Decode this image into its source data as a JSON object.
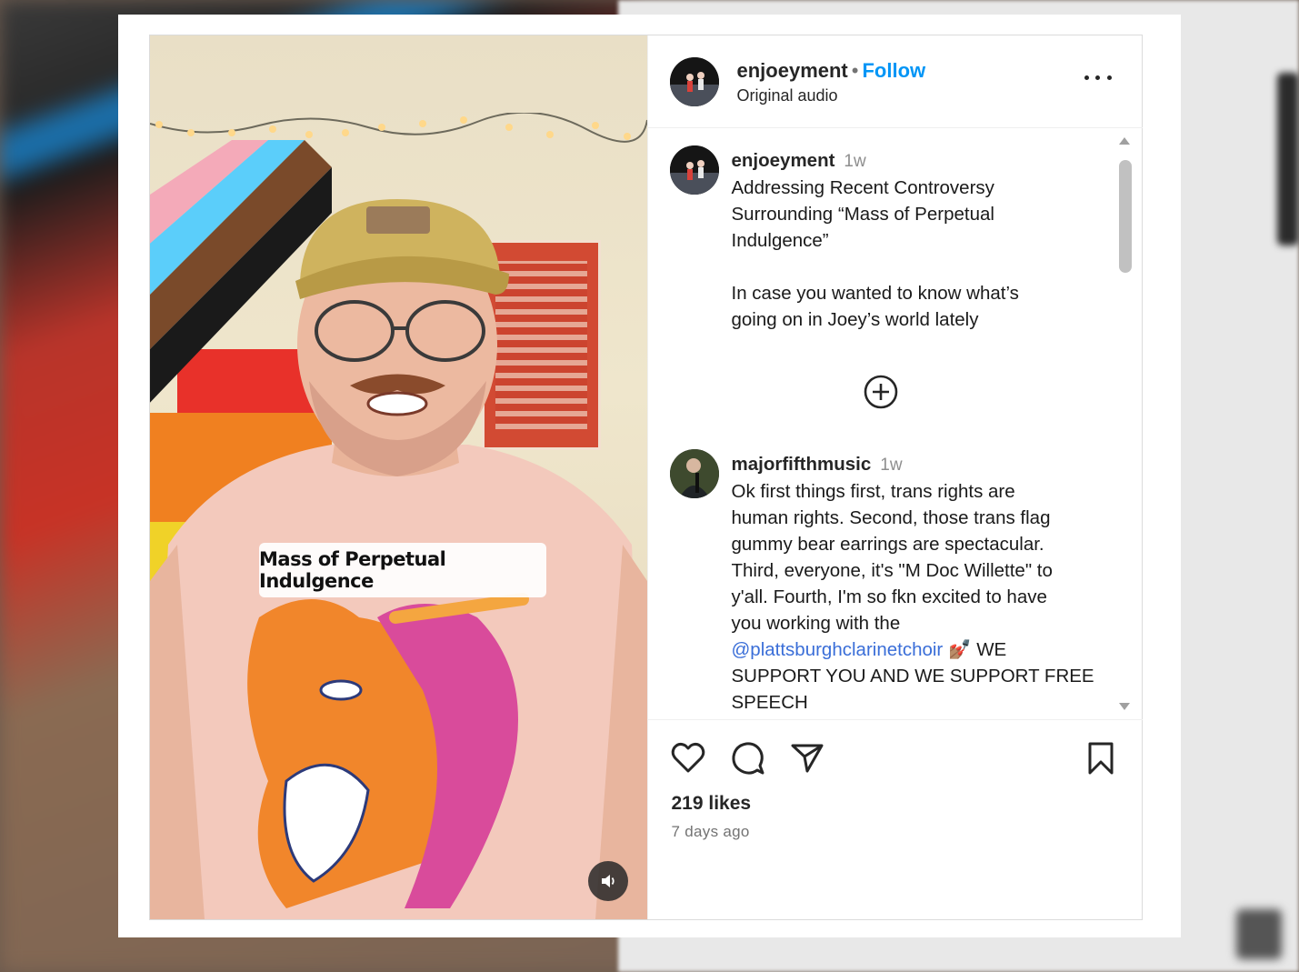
{
  "post": {
    "author": "enjoeyment",
    "separator": "•",
    "follow_label": "Follow",
    "audio_label": "Original audio",
    "video_caption": "Mass of Perpetual Indulgence"
  },
  "caption": {
    "author": "enjoeyment",
    "time": "1w",
    "text_line1": "Addressing Recent Controversy",
    "text_line2": "Surrounding “Mass of Perpetual",
    "text_line3": "Indulgence”",
    "text_line4": "In case you wanted to know what’s",
    "text_line5": "going on in Joey’s world lately"
  },
  "comment": {
    "author": "majorfifthmusic",
    "time": "1w",
    "text_line1": "Ok first things first, trans rights are",
    "text_line2": "human rights. Second, those trans flag",
    "text_line3": "gummy bear earrings are spectacular.",
    "text_line4": "Third, everyone, it's \"M Doc Willette\" to",
    "text_line5": "y'all. Fourth, I'm so fkn excited to have",
    "text_line6": "you working with the",
    "mention": "@plattsburghclarinetchoir",
    "emoji": "💅🏽",
    "text_line7_after": " WE",
    "text_line8": "SUPPORT YOU AND WE SUPPORT FREE",
    "text_line9": "SPEECH"
  },
  "engagement": {
    "likes": "219 likes",
    "date": "7 days ago"
  },
  "icons": {
    "like": "heart-icon",
    "comment": "comment-bubble-icon",
    "share": "paper-plane-icon",
    "save": "bookmark-icon",
    "more": "more-options-icon",
    "load_more": "plus-circle-icon",
    "mute": "speaker-icon"
  },
  "colors": {
    "follow": "#0095f6",
    "mention": "#3a6ed8",
    "muted_text": "#737373"
  }
}
